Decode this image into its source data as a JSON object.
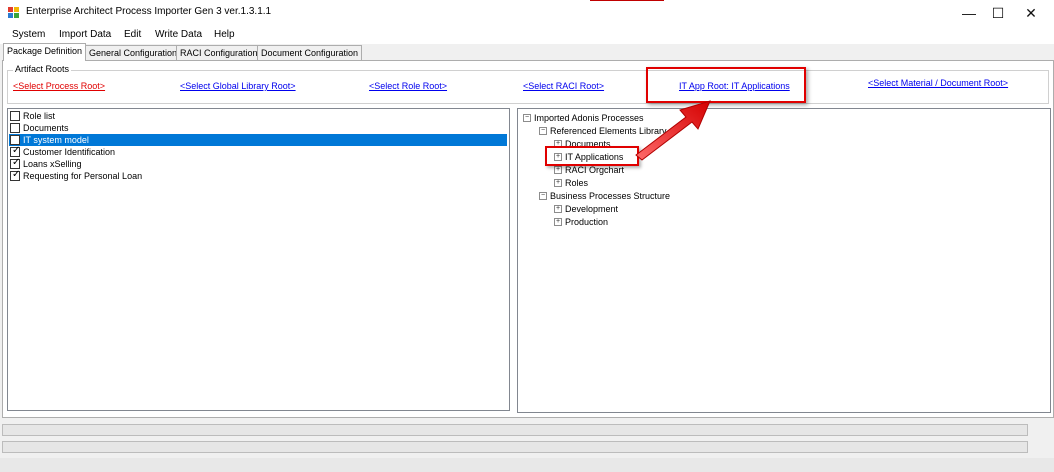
{
  "window": {
    "title": "Enterprise Architect Process Importer Gen 3 ver.1.3.1.1",
    "controls": {
      "minimize": "—",
      "maximize": "☐",
      "close": "✕"
    }
  },
  "menu": [
    "System",
    "Import Data",
    "Edit",
    "Write Data",
    "Help"
  ],
  "tabs": [
    "Package Definition",
    "General Configuration",
    "RACI Configuration",
    "Document Configuration"
  ],
  "active_tab": "Package Definition",
  "artifact_roots": {
    "legend": "Artifact Roots",
    "process_root": "<Select Process Root>",
    "global_library_root": "<Select Global Library Root>",
    "role_root": "<Select Role Root>",
    "raci_root": "<Select RACI Root>",
    "it_app_root": "IT App Root: IT Applications",
    "material_document_root": "<Select Material / Document Root>"
  },
  "package_list": [
    {
      "label": "Role list",
      "checked": false,
      "selected": false
    },
    {
      "label": "Documents",
      "checked": false,
      "selected": false
    },
    {
      "label": "IT system model",
      "checked": false,
      "selected": true
    },
    {
      "label": "Customer Identification",
      "checked": true,
      "selected": false
    },
    {
      "label": "Loans xSelling",
      "checked": true,
      "selected": false
    },
    {
      "label": "Requesting for Personal Loan",
      "checked": true,
      "selected": false
    }
  ],
  "tree": {
    "root": "Imported Adonis Processes",
    "referenced_elements_library": "Referenced Elements Library",
    "documents": "Documents",
    "it_applications": "IT Applications",
    "raci_orgchart": "RACI Orgchart",
    "roles": "Roles",
    "business_processes_structure": "Business Processes Structure",
    "development": "Development",
    "production": "Production"
  },
  "tree_toggles": {
    "expanded": "−",
    "collapsed": "+"
  },
  "colors": {
    "selection": "#0078d7",
    "link": "#0000ee",
    "link_alert": "#e00000",
    "highlight": "#e00000"
  }
}
